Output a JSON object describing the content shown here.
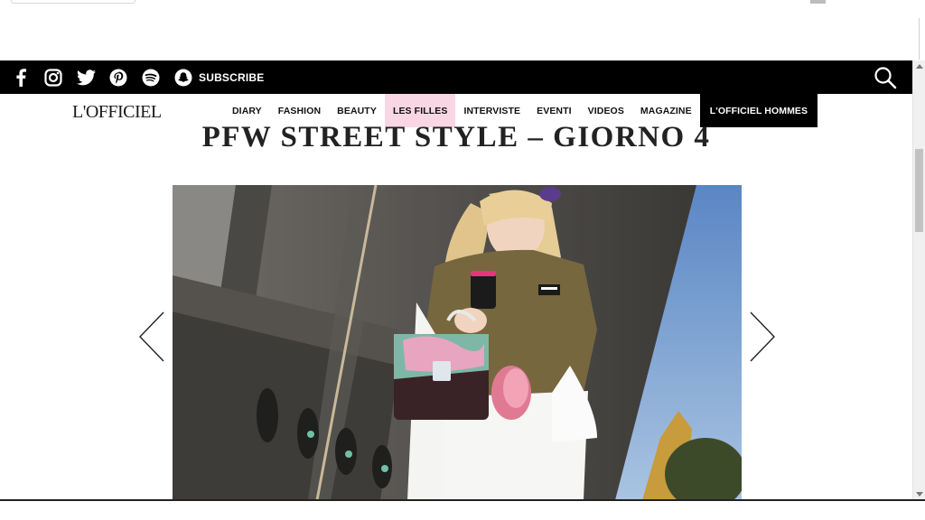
{
  "social": {
    "icons": [
      "facebook-icon",
      "instagram-icon",
      "twitter-icon",
      "pinterest-icon",
      "spotify-icon",
      "snapchat-icon"
    ],
    "subscribe_label": "SUBSCRIBE"
  },
  "brand": {
    "logo_text": "L'OFFICIEL"
  },
  "nav": {
    "items": [
      {
        "label": "DIARY"
      },
      {
        "label": "FASHION"
      },
      {
        "label": "BEAUTY"
      },
      {
        "label": "LES FILLES"
      },
      {
        "label": "INTERVISTE"
      },
      {
        "label": "EVENTI"
      },
      {
        "label": "VIDEOS"
      },
      {
        "label": "MAGAZINE"
      },
      {
        "label": "L'OFFICIEL HOMMES"
      }
    ],
    "highlight_color": "#f8d6e3"
  },
  "article": {
    "title": "PFW STREET STYLE – GIORNO 4"
  },
  "colors": {
    "bar_black": "#000000",
    "background": "#ffffff"
  }
}
